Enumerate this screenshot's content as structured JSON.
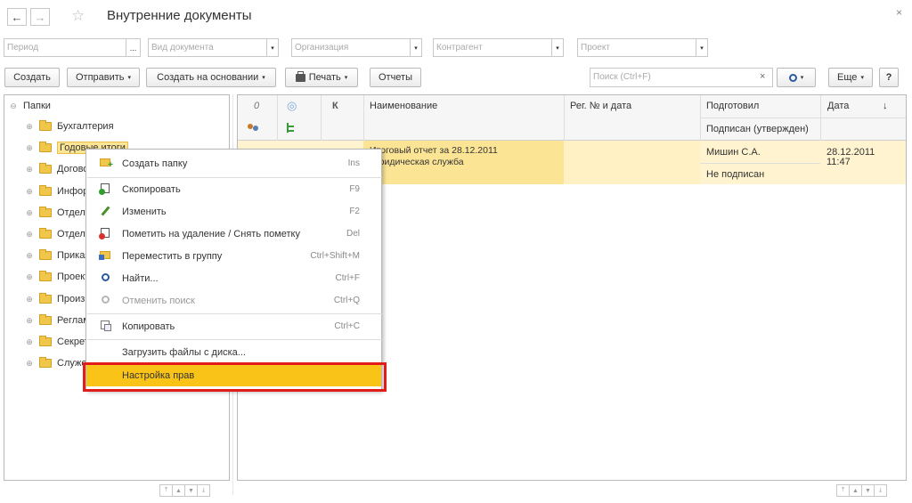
{
  "window": {
    "title": "Внутренние документы",
    "back_icon": "←",
    "forward_icon": "→",
    "star_icon": "☆",
    "close_icon": "×"
  },
  "filters": {
    "period_placeholder": "Период",
    "period_btn": "...",
    "doc_type_placeholder": "Вид документа",
    "org_placeholder": "Организация",
    "contractor_placeholder": "Контрагент",
    "project_placeholder": "Проект",
    "dd": "▾"
  },
  "toolbar": {
    "create": "Создать",
    "send": "Отправить",
    "create_based": "Создать на основании",
    "print": "Печать",
    "reports": "Отчеты",
    "search_placeholder": "Поиск (Ctrl+F)",
    "clear": "×",
    "search_icon": "🔍",
    "more": "Еще",
    "help": "?",
    "arrow": "▾"
  },
  "tree": {
    "root": "Папки",
    "root_toggle": "⊖",
    "toggle": "⊕",
    "items": [
      {
        "label": "Бухгалтерия"
      },
      {
        "label": "Годовые итоги"
      },
      {
        "label": "Договоры"
      },
      {
        "label": "Информация"
      },
      {
        "label": "Отдел кадров"
      },
      {
        "label": "Отдел продаж"
      },
      {
        "label": "Приказы"
      },
      {
        "label": "Проекты"
      },
      {
        "label": "Производство"
      },
      {
        "label": "Регламенты"
      },
      {
        "label": "Секретариат"
      },
      {
        "label": "Служебные"
      }
    ]
  },
  "table": {
    "columns": {
      "clip": "0",
      "circle": "◎",
      "k": "К",
      "name": "Наименование",
      "reg": "Рег. № и дата",
      "prepared": "Подготовил",
      "signed": "Подписан (утвержден)",
      "date": "Дата",
      "sort": "↓"
    },
    "rows": [
      {
        "name_line1": "Итоговый отчет за 28.12.2011",
        "name_line2": "Юридическая служба",
        "prepared": "Мишин С.А.",
        "signed": "Не подписан",
        "date": "28.12.2011",
        "time": "11:47"
      }
    ]
  },
  "context_menu": {
    "items": [
      {
        "label": "Создать папку",
        "shortcut": "Ins",
        "icon": "create-folder-icon"
      },
      {
        "label": "Скопировать",
        "shortcut": "F9",
        "icon": "copy-item-icon"
      },
      {
        "label": "Изменить",
        "shortcut": "F2",
        "icon": "edit-pencil-icon"
      },
      {
        "label": "Пометить на удаление / Снять пометку",
        "shortcut": "Del",
        "icon": "mark-delete-icon"
      },
      {
        "label": "Переместить в группу",
        "shortcut": "Ctrl+Shift+M",
        "icon": "move-group-icon"
      },
      {
        "label": "Найти...",
        "shortcut": "Ctrl+F",
        "icon": "find-icon"
      },
      {
        "label": "Отменить поиск",
        "shortcut": "Ctrl+Q",
        "icon": "cancel-search-icon"
      },
      {
        "label": "Копировать",
        "shortcut": "Ctrl+C",
        "icon": "copy-clipboard-icon"
      },
      {
        "label": "Загрузить файлы с диска..."
      },
      {
        "label": "Настройка прав"
      }
    ]
  },
  "scroll": {
    "first": "⤒",
    "up": "▲",
    "down": "▼",
    "last": "⤓"
  },
  "colors": {
    "highlight": "#f9c417",
    "row_selected": "#fbe595",
    "annotation_red": "#e21b1b"
  }
}
